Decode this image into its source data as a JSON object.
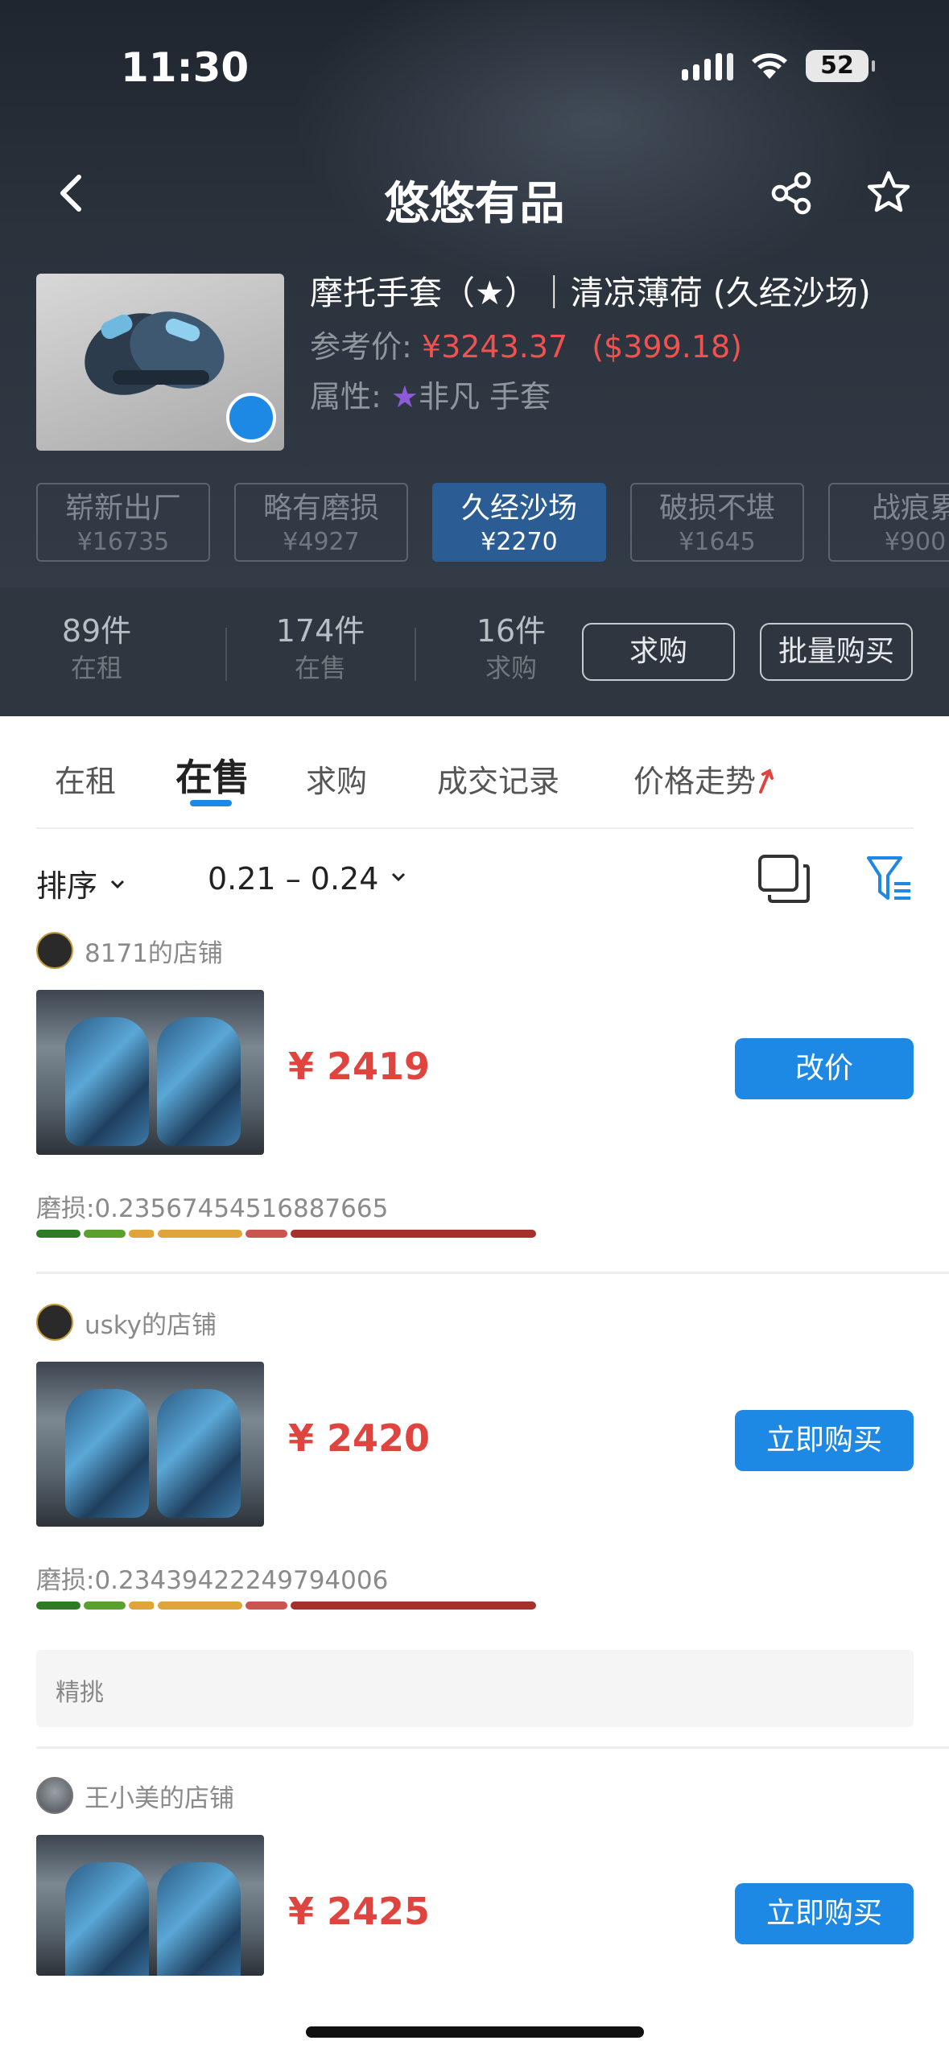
{
  "status": {
    "time": "11:30",
    "battery": "52"
  },
  "nav": {
    "title": "悠悠有品"
  },
  "item": {
    "name": "摩托手套（★）｜清凉薄荷 (久经沙场)",
    "ref_label": "参考价: ",
    "ref_price_cny": "¥3243.37",
    "ref_price_usd": "($399.18)",
    "attr_label": "属性: ",
    "attr_star": "★",
    "attr_value": "非凡 手套"
  },
  "wear_tabs": [
    {
      "name": "崭新出厂",
      "price": "¥16735",
      "active": false
    },
    {
      "name": "略有磨损",
      "price": "¥4927",
      "active": false
    },
    {
      "name": "久经沙场",
      "price": "¥2270",
      "active": true
    },
    {
      "name": "破损不堪",
      "price": "¥1645",
      "active": false
    },
    {
      "name": "战痕累",
      "price": "¥900",
      "active": false
    }
  ],
  "stats": [
    {
      "value": "89件",
      "label": "在租"
    },
    {
      "value": "174件",
      "label": "在售"
    },
    {
      "value": "16件",
      "label": "求购"
    }
  ],
  "stat_buttons": {
    "request": "求购",
    "bulk": "批量购买"
  },
  "content_tabs": [
    "在租",
    "在售",
    "求购",
    "成交记录",
    "价格走势"
  ],
  "filter": {
    "sort": "排序",
    "range": "0.21 – 0.24"
  },
  "listings": [
    {
      "seller": "8171的店铺",
      "price": "¥ 2419",
      "button": "改价",
      "wear_label": "磨损:",
      "wear_value": "0.23567454516887665",
      "wear_fraction": 0.2357
    },
    {
      "seller": "usky的店铺",
      "price": "¥ 2420",
      "button": "立即购买",
      "wear_label": "磨损:",
      "wear_value": "0.23439422249794006",
      "wear_fraction": 0.2344,
      "tag": "精挑"
    },
    {
      "seller": "王小美的店铺",
      "price": "¥ 2425",
      "button": "立即购买"
    }
  ],
  "colors": {
    "accent": "#1e88e5",
    "price_red": "#e0443f",
    "header_bg": "#2a323c",
    "active_wear_tab": "#2b5d94"
  }
}
